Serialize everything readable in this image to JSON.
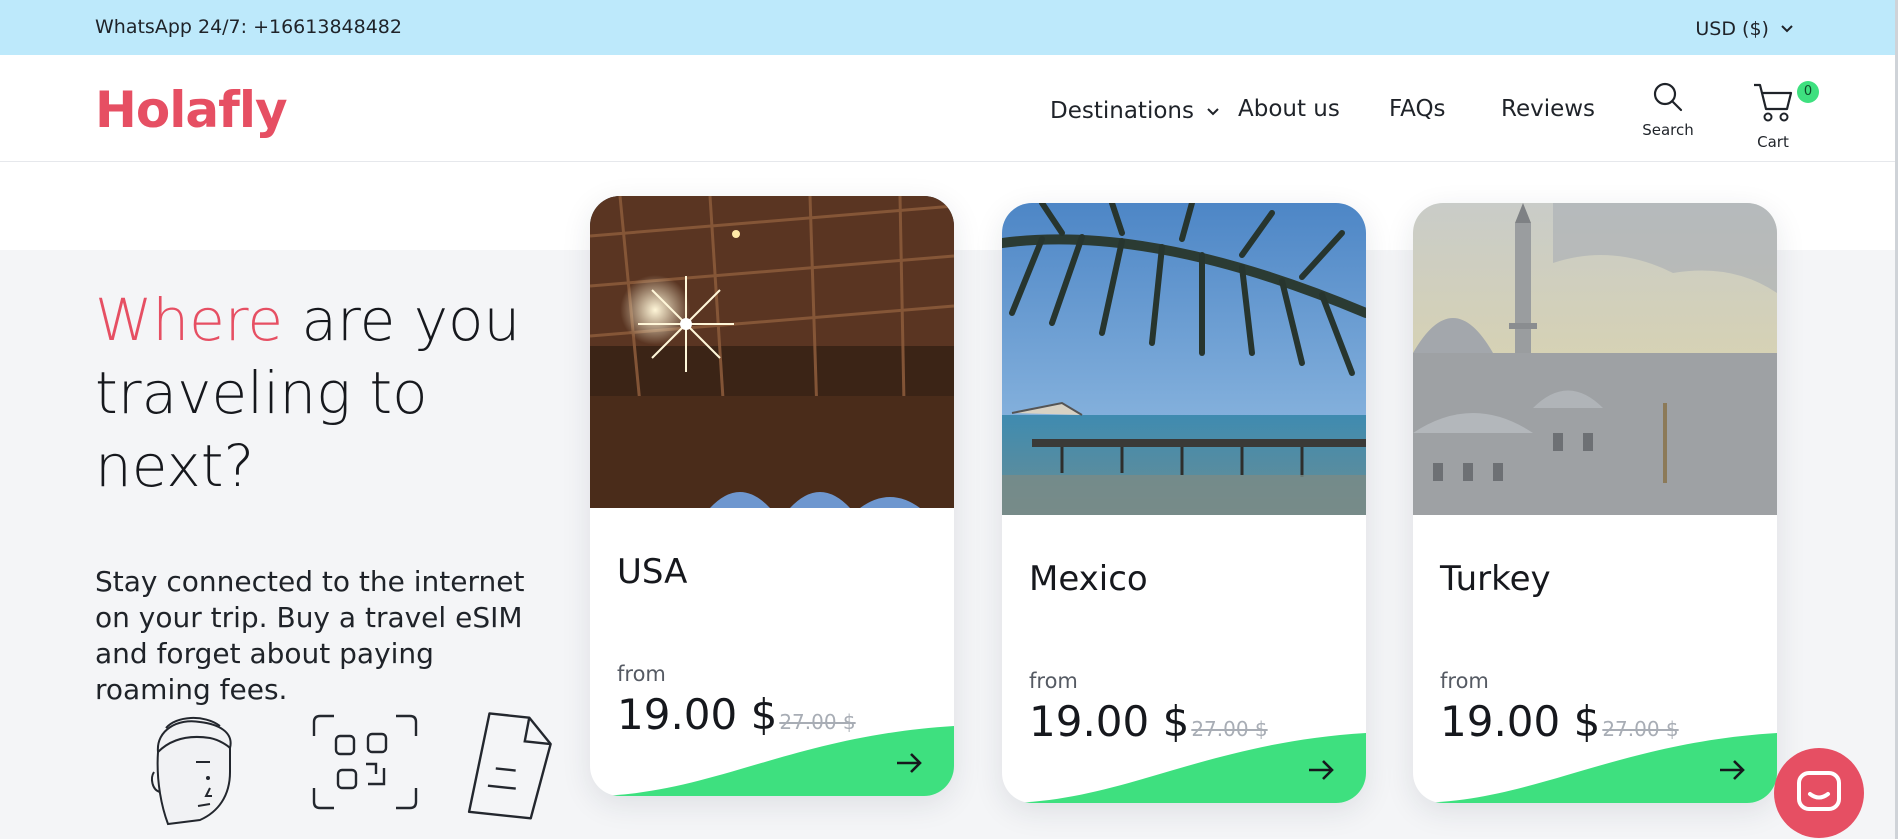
{
  "topbar": {
    "whatsapp": "WhatsApp 24/7: +16613848482",
    "currency": "USD ($)"
  },
  "header": {
    "logo": "Holafly",
    "nav": {
      "destinations": "Destinations",
      "about": "About us",
      "faqs": "FAQs",
      "reviews": "Reviews"
    },
    "search_label": "Search",
    "cart_label": "Cart",
    "cart_count": "0"
  },
  "hero": {
    "headline_accent": "Where",
    "headline_rest": " are you traveling to next?",
    "subtext": "Stay connected to the internet on your trip. Buy a travel eSIM and forget about paying roaming fees."
  },
  "destinations": [
    {
      "country": "USA",
      "from_label": "from",
      "price": "19.00 $",
      "old_price": "27.00 $"
    },
    {
      "country": "Mexico",
      "from_label": "from",
      "price": "19.00 $",
      "old_price": "27.00 $"
    },
    {
      "country": "Turkey",
      "from_label": "from",
      "price": "19.00 $",
      "old_price": "27.00 $"
    }
  ],
  "colors": {
    "brand": "#e64f63",
    "topbar": "#bde9fb",
    "accent_green": "#3ee07f",
    "hero_bg": "#f4f5f7"
  },
  "icons": {
    "search": "search-icon",
    "cart": "cart-icon",
    "arrow": "arrow-right-icon",
    "chat": "chat-icon",
    "chevron": "chevron-down-icon"
  }
}
